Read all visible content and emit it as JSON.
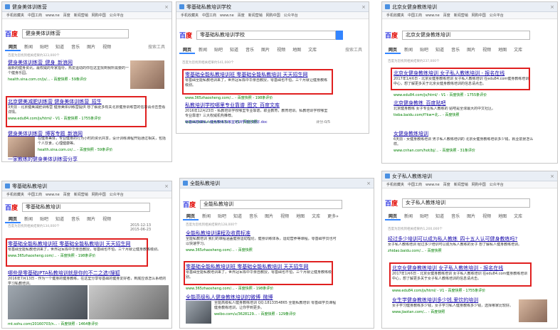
{
  "bookmarks": [
    "手机收藏夹",
    "中国工商",
    "www.ne",
    "百度",
    "新闻营销",
    "网购中国",
    "公众平台"
  ],
  "nav_tabs": [
    "网页",
    "新闻",
    "贴吧",
    "知道",
    "音乐",
    "图片",
    "视频",
    "地图",
    "文库",
    "更多»"
  ],
  "search_tools": "搜索工具",
  "panels": {
    "p1": {
      "tab_title": "健身美体训练营",
      "query": "健身美体训练营",
      "count": "百度为您找到相关结果约323,000个",
      "r1_title": "健身美体训练营_健身_新浪网",
      "r1_desc": "最新的健身资讯，最权威的专家指导，热爱运动的你在这里找到我所需要的一个健身乐园。",
      "r1_url": "health.sina.com.cn/js/... - 百度快照 - 59条评价",
      "r2_title": "北京健美减肥训练营 健身美体训练营_招生",
      "r2_desc": "3天前 - 北京健美减肥训练营 健身美体训练营提供 想了解更多有关北京健身训练营的信息请点击查看详情。",
      "r2_url": "www.edu84.com/js/html/ - V1 - 百度快照 - 1755条评价",
      "r3_title": "健身美体训练营_博客专题_新浪网",
      "r3_desc": "在健身美体，专业健身的行为小时的资讯共享，设计训练课程开始通过相关，包括个人饮食，心理健康等。",
      "r3_url": "health.sina.com.cn/... - 百度快照 - 59条评价",
      "r4_title": "一家教练的健身美体训练营分享"
    },
    "p2": {
      "tab_title": "零基础私教培训学校",
      "query": "零基础私教培训学校",
      "count": "百度为您找到相关结果约541,000个",
      "r1_title": "零基础全能私教培训班 零基础全能私教培训 天天招生网",
      "r1_desc": "零基础全能私教培训来了，世界冠军陈中华亲自教授，零基础也不怕，三个月就让健身教练级别。",
      "r1_url": "www.365zhaosheng.com/... - 百度快照 - 198条评价",
      "r2_title": "私教培训学校哪里专业靠谱_图文_百度文库",
      "r2_desc": "2016年12月23日 - 私教培训学校哪里专业靠谱，职业教育，教育培训。私教培训学校哪里专业靠谱？三大权威机构推荐。",
      "r2_url": "wenku.baidu.com/link?u... - V1 - 百度快照",
      "sub1": "零基础想做私人健身教练去哪里培训学校比较好.doc",
      "sub1_score": "评分:0/5",
      "sub2": "零基础学私人健身教练多少钱.doc",
      "sub2_score": "评分:0/5",
      "sub3": "私人健身教练培训学校有哪些.doc",
      "sub3_score": "评分:0/5"
    },
    "p3": {
      "tab_title": "北京女健身教练培训",
      "query": "北京女健身教练培训",
      "count": "百度为您找到相关结果约237,000个",
      "r1_title": "北京女健身教练培训 女子私人教练培训 - 报名在线",
      "r1_desc": "2017年1月6日 - 北京女健身教练培训 女子私人教练培训 在edu84.com健身教练培训中心，想了解更多关于北京女健身教练培训的信息请点击。",
      "r1_url": "www.edu84.com/js/html/ - V1 - 百度快照 - 1755条评价",
      "r2_title": "北京健身教练_百度贴吧",
      "r2_desc": "北京健身教练 女子专业私人教练的 贴吧是全球最大的中文社区。",
      "r2_url": "tieba.baidu.com/f?kw=北... - 百度快照",
      "r3_title": "女健身教练培训",
      "r3_desc": "6天前 - 女健身教练培训 男子私人教练培训的 北京女健身教练培训多少钱，就业前景怎么样。",
      "r3_url": "www.cnhan.com/hot/bj/... - 百度快照 - 31条评价"
    },
    "p4": {
      "tab_title": "零基础私教培训",
      "query": "零基础私教培训",
      "count": "百度为您找到相关结果约134,000个",
      "date1": "2015-12-13",
      "date2": "2015-06-23",
      "r1_title": "零基础全能私教培训班 零基础全能私教培训 天天招生网",
      "r1_desc": "零基础全能私教培训来了，世界冠军陈中华亲自教授，零基础也不怕，三个月就让健身教练级别。",
      "r1_url": "www.365zhaosheng.com/... - 百度快照 - 198条评价",
      "r2_title": "哪些是零基础JPTA私教培训就是你的不二之选!搜狐",
      "r2_desc": "2016年7月13日 - 作为一个健身的健身教练，在这里分享零基础的健身爱好者，到底应该怎么系统的学习私教培训。",
      "r2_url": "mt.sohu.com/20160703/n... - 百度快照 - 1464条评价"
    },
    "p5": {
      "tab_title": "全能私教培训",
      "query": "全能私教培训",
      "count": "百度为您找到相关结果约128,000个",
      "r1_title": "全能私教培训课程及收费标准",
      "r1_desc": "全能私教培训 我们的课程涵盖健身运动理论，健身训练体系，运动营养等课程，零基础学员也可以快速学习。",
      "r1_url": "www.365zhaosheng.com/... - 百度快照",
      "r2_title": "零基础全能私教培训班 零基础全能私教培训 天天招生网",
      "r2_desc": "零基础全能私教培训来了，世界冠军陈中华亲自教授，零基础也不怕，三个月就让健身教练级别。",
      "r2_url": "www.365zhaosheng.com/... - 百度快照 - 198条评价",
      "r3_title": "全能高级私人健身教练培训的微博_微博",
      "r3_desc": "全能高级私人健身教练培训 QQ:1813354865 全能私教培训 零基础学员课程 健身教练培训，让你学到更多。",
      "r3_url": "weibo.com/u/3628129... - 百度快照 - 129条评价"
    },
    "p6": {
      "tab_title": "女子私人教练培训",
      "query": "女子私人教练培训",
      "count": "百度为您找到相关结果约1,200,000个",
      "r1_title": "经过多少培训可以成为私人教练_四十五人认可健身教练吗?",
      "r1_desc": "女子私人教练培训 经过多少培训可以成为私人教练的女子 想了解私人健身教练培训。",
      "r1_url": "zhidao.baidu.com/... - 百度快照",
      "r2_title": "北京女健身教练培训 女子私人教练培训 - 报名在线",
      "r2_desc": "2017年1月6日 - 北京女健身教练培训 女子私人教练培训 在edu84.com健身教练培训中心，想了解更多关于女子私人教练培训的信息请点击。",
      "r2_url": "www.edu84.com/js/html/ - V1 - 百度快照 - 1755条评价",
      "r3_title": "女生学健身教练培训多少钱,爱炊的培训",
      "r3_desc": "女子学习健身教练多少钱，女子学习私人健身教练多少钱，选择哪家比较好。",
      "r3_url": "www.jiaotan.com/... - 百度快照"
    }
  }
}
